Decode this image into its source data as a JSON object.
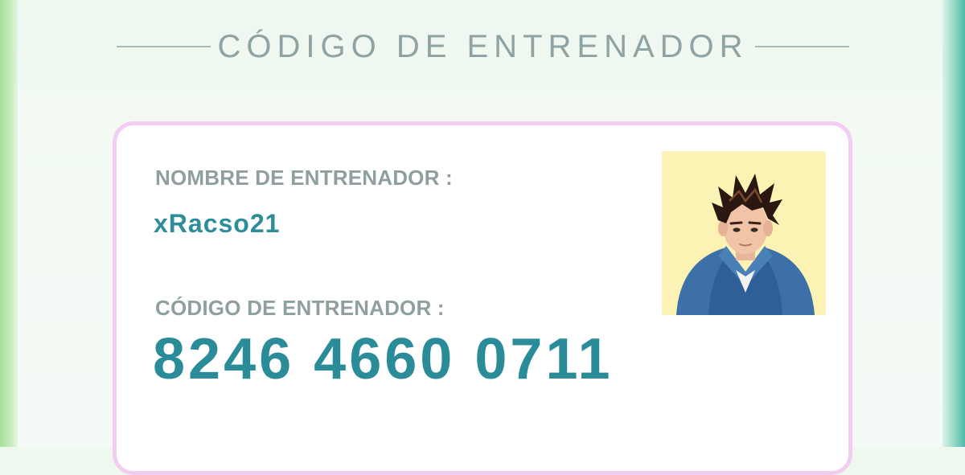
{
  "header": {
    "title": "CÓDIGO DE ENTRENADOR"
  },
  "card": {
    "trainer_name_label": "NOMBRE DE ENTRENADOR :",
    "trainer_name": "xRacso21",
    "trainer_code_label": "CÓDIGO DE ENTRENADOR :",
    "trainer_code": "8246 4660 0711"
  },
  "avatar": {
    "icon": "trainer-avatar-icon"
  },
  "colors": {
    "accent_teal": "#2a8c99",
    "label_gray": "#8f9fa0",
    "card_border_pink": "#f2cdf1",
    "avatar_bg": "#fbf2b4",
    "background_mint": "#eef8ee"
  }
}
